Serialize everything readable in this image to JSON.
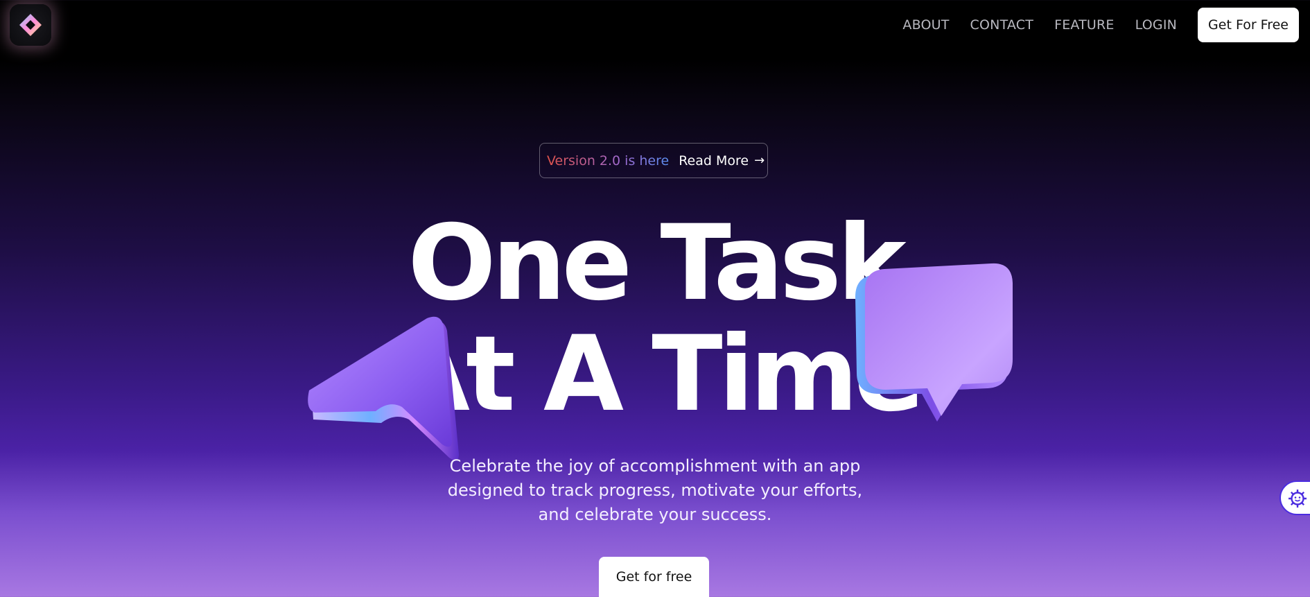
{
  "nav": {
    "links": [
      "ABOUT",
      "CONTACT",
      "FEATURE",
      "LOGIN"
    ],
    "cta_label": "Get For Free",
    "logo_icon": "diamond-logo-icon"
  },
  "announcement": {
    "version_text": "Version 2.0 is here",
    "read_more_label": "Read More",
    "arrow": "→"
  },
  "hero": {
    "headline_line1": "One Task",
    "headline_line2": "At A Time",
    "subtext": "Celebrate the joy of accomplishment with an app designed to track progress, motivate your efforts, and celebrate your success.",
    "cta_label": "Get for free"
  },
  "floating": {
    "settings_icon": "gear-face-icon"
  },
  "colors": {
    "accent": "#4b2de0",
    "gradient_top": "#000000",
    "gradient_bottom": "#a878e2"
  }
}
